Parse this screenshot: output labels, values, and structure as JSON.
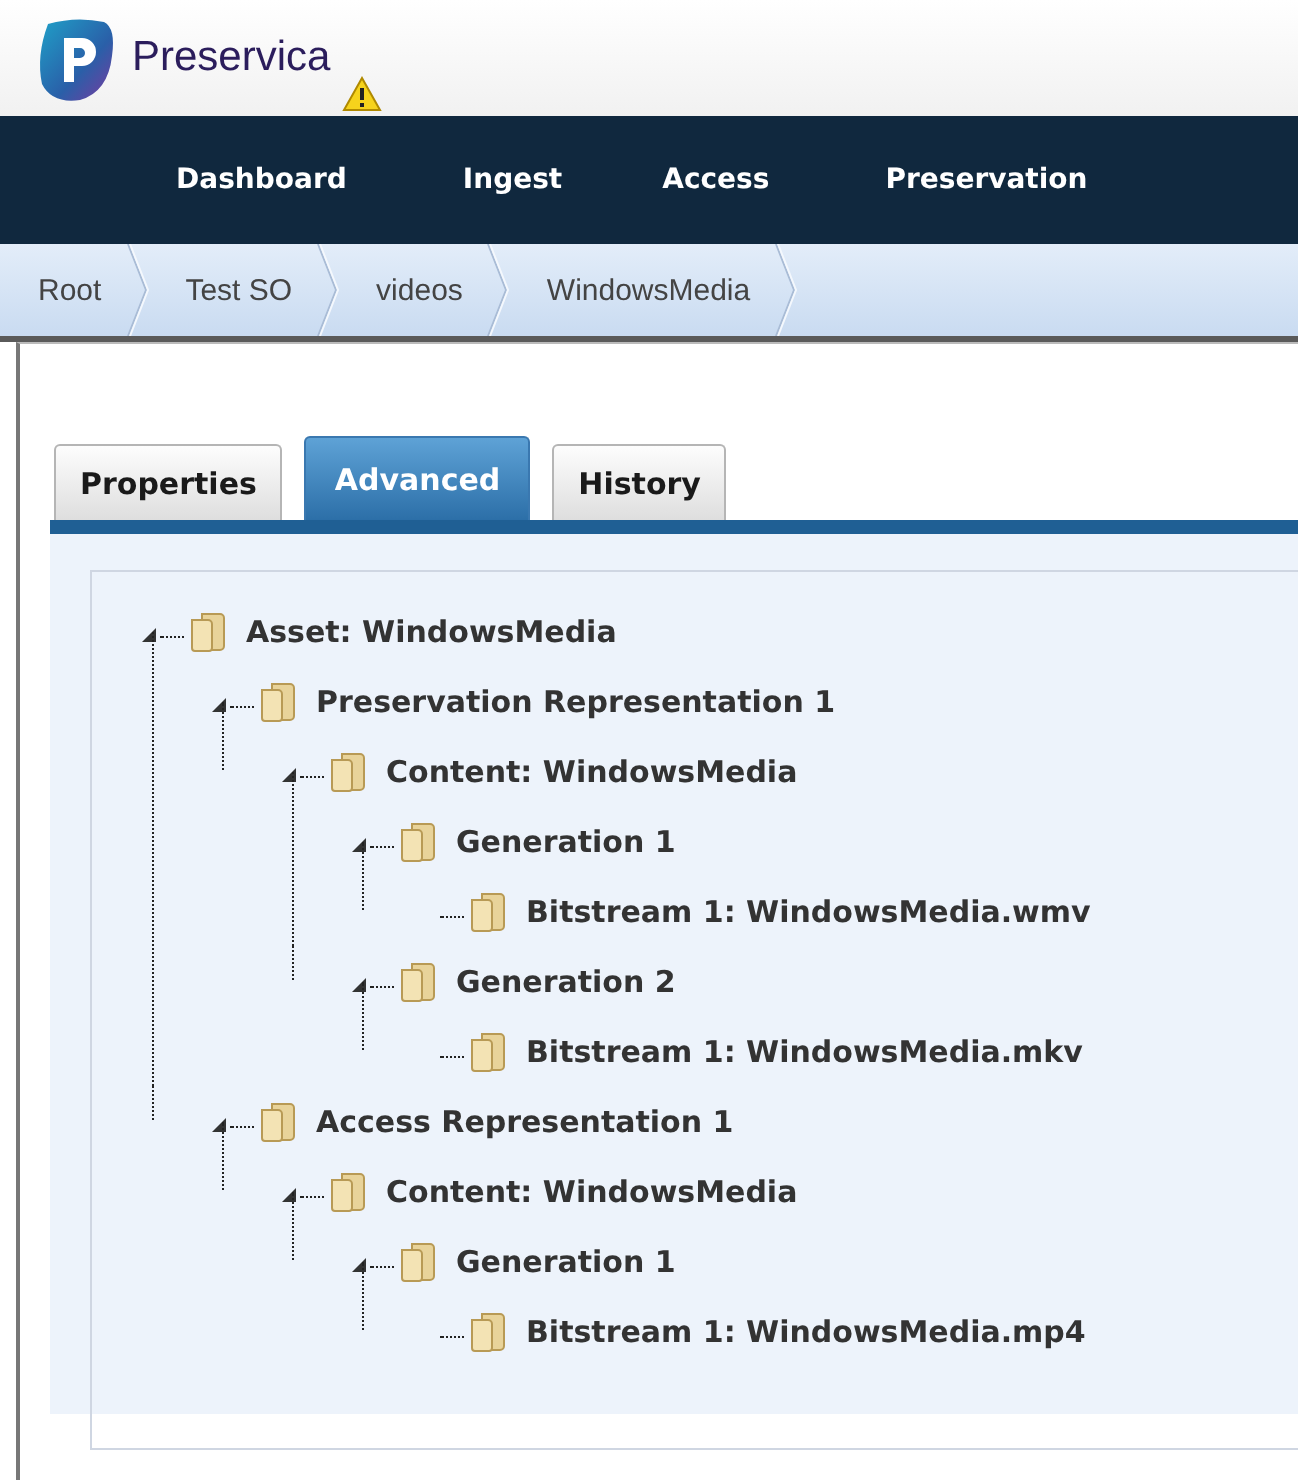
{
  "header": {
    "product_name": "Preservica"
  },
  "nav": [
    {
      "label": "Dashboard"
    },
    {
      "label": "Ingest"
    },
    {
      "label": "Access"
    },
    {
      "label": "Preservation"
    }
  ],
  "breadcrumb": [
    "Root",
    "Test SO",
    "videos",
    "WindowsMedia"
  ],
  "tabs": [
    {
      "label": "Properties",
      "selected": false
    },
    {
      "label": "Advanced",
      "selected": true
    },
    {
      "label": "History",
      "selected": false
    }
  ],
  "tree": [
    {
      "label": "Asset: WindowsMedia",
      "expanded": true,
      "children": [
        {
          "label": "Preservation Representation 1",
          "expanded": true,
          "children": [
            {
              "label": "Content: WindowsMedia",
              "expanded": true,
              "children": [
                {
                  "label": "Generation 1",
                  "expanded": true,
                  "children": [
                    {
                      "label": "Bitstream 1: WindowsMedia.wmv"
                    }
                  ]
                },
                {
                  "label": "Generation 2",
                  "expanded": true,
                  "children": [
                    {
                      "label": "Bitstream 1: WindowsMedia.mkv"
                    }
                  ]
                }
              ]
            }
          ]
        },
        {
          "label": "Access Representation 1",
          "expanded": true,
          "children": [
            {
              "label": "Content: WindowsMedia",
              "expanded": true,
              "children": [
                {
                  "label": "Generation 1",
                  "expanded": true,
                  "children": [
                    {
                      "label": "Bitstream 1: WindowsMedia.mp4"
                    }
                  ]
                }
              ]
            }
          ]
        }
      ]
    }
  ]
}
